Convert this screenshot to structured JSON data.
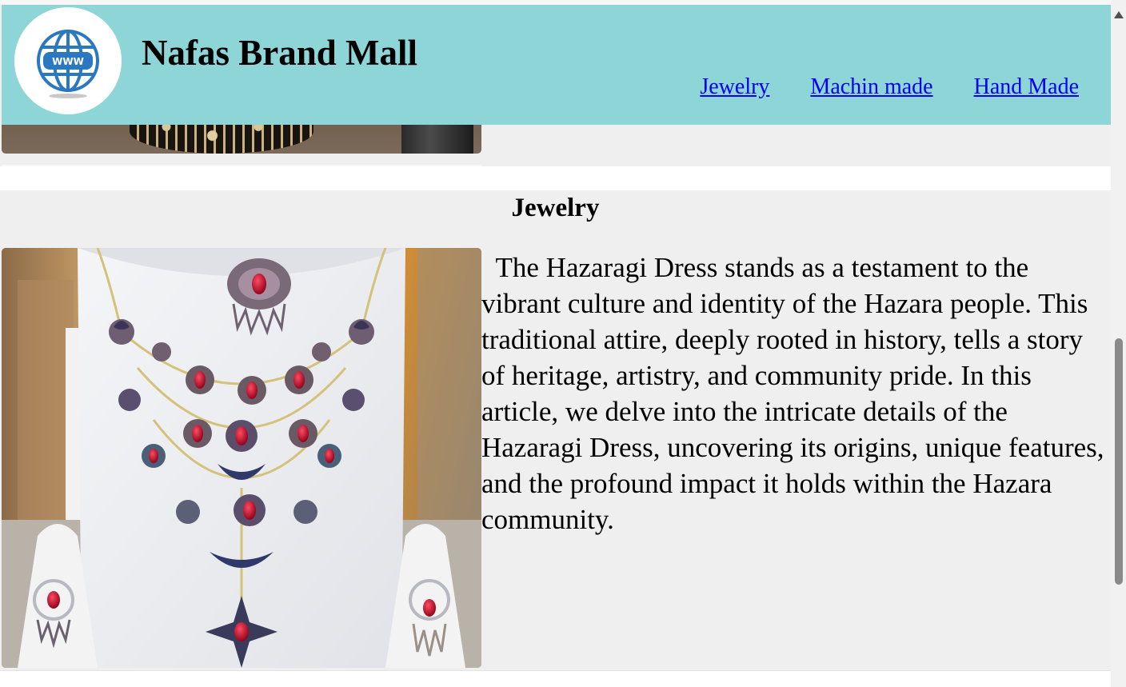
{
  "header": {
    "brand_title": "Nafas Brand Mall",
    "logo_icon": "www-globe-icon",
    "logo_text": "WWW",
    "nav": [
      {
        "label": "Jewelry"
      },
      {
        "label": "Machin made"
      },
      {
        "label": "Hand Made"
      }
    ]
  },
  "colors": {
    "header_bg": "#8dd5d6",
    "section_bg": "#efefef",
    "link": "#0000ee"
  },
  "jewelry_section": {
    "title": "Jewelry",
    "image_alt": "Hazaragi necklace and earrings on display stand",
    "description": "  The Hazaragi Dress stands as a testament to the vibrant culture and identity of the Hazara people. This traditional attire, deeply rooted in history, tells a story of heritage, artistry, and community pride. In this article, we delve into the intricate details of the Hazaragi Dress, uncovering its origins, unique features, and the profound impact it holds within the Hazara community."
  }
}
